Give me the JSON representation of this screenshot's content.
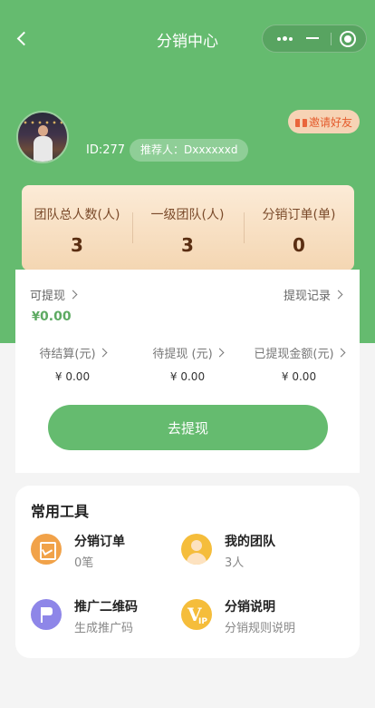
{
  "nav": {
    "title": "分销中心"
  },
  "profile": {
    "id_text": "ID:277",
    "referrer_text": "推荐人：Dxxxxxxd",
    "invite_label": "邀请好友"
  },
  "stats": [
    {
      "label": "团队总人数(人)",
      "value": "3"
    },
    {
      "label": "一级团队(人)",
      "value": "3"
    },
    {
      "label": "分销订单(单)",
      "value": "0"
    }
  ],
  "balance": {
    "withdrawable_label": "可提现",
    "records_link": "提现记录",
    "currency": "¥",
    "amount": "0.00",
    "sub_items": [
      {
        "label": "待结算(元)",
        "value": "¥ 0.00"
      },
      {
        "label": "待提现 (元)",
        "value": "¥ 0.00"
      },
      {
        "label": "已提现金额(元)",
        "value": "¥ 0.00"
      }
    ],
    "withdraw_button": "去提现"
  },
  "tools": {
    "title": "常用工具",
    "items": [
      {
        "name": "分销订单",
        "desc": "0笔",
        "icon": "order-icon"
      },
      {
        "name": "我的团队",
        "desc": "3人",
        "icon": "team-icon"
      },
      {
        "name": "推广二维码",
        "desc": "生成推广码",
        "icon": "flag-icon"
      },
      {
        "name": "分销说明",
        "desc": "分销规则说明",
        "icon": "vip-icon"
      }
    ]
  },
  "colors": {
    "primary": "#65bb6f",
    "stats_card": "#f4d6b2",
    "amount": "#5daa62",
    "invite_text": "#e45a2b"
  }
}
